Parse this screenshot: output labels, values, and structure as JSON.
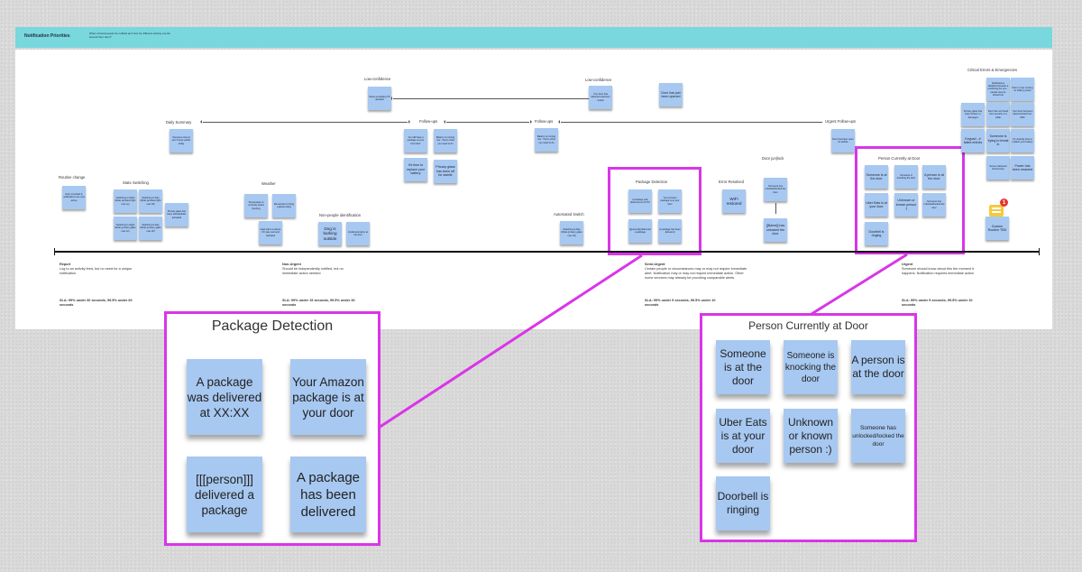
{
  "header": {
    "title": "Notification Priorities",
    "subtitle": "When should people be notified and how for different activity events around their door?"
  },
  "groups": {
    "routine_change": {
      "label": "Routine change",
      "notes": [
        "Door is locked & notifications are now active"
      ]
    },
    "state_switching": {
      "label": "State Switching",
      "notes": [
        "Switching to Night Mode (ambient light now on)",
        "Switching to Day Mode (ambient light now off)",
        "Switching to Night Mode (privacy glass now on)",
        "Switching to Day Mode (privacy glass now off)",
        "Privacy glass has been activated/de-activated"
      ]
    },
    "daily_summary": {
      "label": "Daily Summary",
      "notes": [
        "Someone was at your house earlier today"
      ]
    },
    "weather": {
      "label": "Weather",
      "notes": [
        "Temperature is currently below freezing",
        "Remember to bring a jacket today",
        "Heat index is above XX stay cool and hydrated"
      ]
    },
    "non_people": {
      "label": "Non-people identification",
      "notes": [
        "Dog is barking outside",
        "A [wild animal] is at the door"
      ]
    },
    "low_conf_1": {
      "label": "Low-confidence",
      "notes": [
        "Noise exceeding XX decibels"
      ]
    },
    "follow_ups_1": {
      "label": "Follow-ups",
      "notes": [
        "You still have a package at your front door",
        "Battery is running low - here's what you need to do",
        "It's time to replace your battery",
        "Privacy glass has been off for awhile"
      ]
    },
    "follow_ups_2": {
      "label": "Follow-ups",
      "notes": [
        "Battery is running low - here's what you need to do"
      ]
    },
    "low_conf_2": {
      "label": "Low-confidence",
      "notes": [
        "Your door has detected unknown motion",
        "Door has just been opened"
      ]
    },
    "automated_switch": {
      "label": "Automated Switch",
      "notes": [
        "Switching to Day Mode (privacy glass now off)"
      ]
    },
    "package_detection": {
      "label": "Package Detection",
      "notes": [
        "A package was delivered at XX:XX",
        "Your Amazon package is at your door",
        "[[[person]]] delivered a package",
        "A package has been delivered"
      ]
    },
    "error_resolved": {
      "label": "Error Resolved",
      "notes": [
        "WiFi restored"
      ]
    },
    "door_jamb": {
      "label": "Door jun|lock",
      "notes": [
        "Someone has unlocked/locked the door",
        "[[Name]] has unlocked the door"
      ]
    },
    "urgent_follow_ups": {
      "label": "Urgent Follow-ups",
      "notes": [
        "Door has been open for awhile"
      ]
    },
    "person_at_door": {
      "label": "Person Currently at Door",
      "notes": [
        "Someone is at the door",
        "Someone is knocking the door",
        "A  person is at the door",
        "Uber Eats is at your door",
        "Unknown or known person :)",
        "Someone has unlocked/locked the door",
        "Doorbell is ringing"
      ]
    },
    "critical": {
      "label": "Critical Errors & Emergencies",
      "notes": [
        "Notifications disabled because a predicting the eco... people may be locked out",
        "Door is now running on battery power",
        "Privacy glass has been broken or damaged",
        "Door has not heard from security in a while",
        "Your door has been disconnected from WiFi",
        "Keypad - # failed entries",
        "Someone is trying to break in",
        "It's urgently time to replace your battery",
        "Sensor detected forced entry",
        "Power has been restored",
        "Custom Routine TBD"
      ]
    }
  },
  "comment_badge": {
    "count": "1",
    "icon": "comment-icon"
  },
  "tiers": [
    {
      "name": "Report",
      "desc": "Log to an activity feed, but no need for a unique notification",
      "sla": "SLA: 99% under 30 seconds, 99.5% under 60 seconds"
    },
    {
      "name": "Non-Urgent",
      "desc": "Should be independently notified, but no immediate action needed",
      "sla": "SLA: 99% under 15 seconds, 99.5% under 30 seconds"
    },
    {
      "name": "Semi-Urgent",
      "desc": "Certain people or circumstances may or may not require immediate alert. Notification may or may not require immediate action. Other home services may already be providing comparable alerts",
      "sla": "SLA: 99% under 5 seconds, 99.5% under 10 seconds"
    },
    {
      "name": "Urgent",
      "desc": "Someone should know about this the moment it happens. Notification requires immediate action",
      "sla": "SLA: 99% under 5 seconds, 99.5% under 10 seconds"
    }
  ],
  "callouts": {
    "package": {
      "title": "Package Detection",
      "notes": [
        "A package was delivered at XX:XX",
        "Your Amazon package is at your door",
        "[[[person]]] delivered a package",
        "A package has been delivered"
      ]
    },
    "person": {
      "title": "Person Currently at Door",
      "notes": [
        "Someone is at the door",
        "Someone is knocking the door",
        "A  person is at the door",
        "Uber Eats is at your door",
        "Unknown or known person :)",
        "Someone has unlocked/locked the door",
        "Doorbell is ringing"
      ]
    }
  },
  "colors": {
    "banner": "#79d7de",
    "sticky": "#a7c8f1",
    "highlight": "#d935e8"
  }
}
